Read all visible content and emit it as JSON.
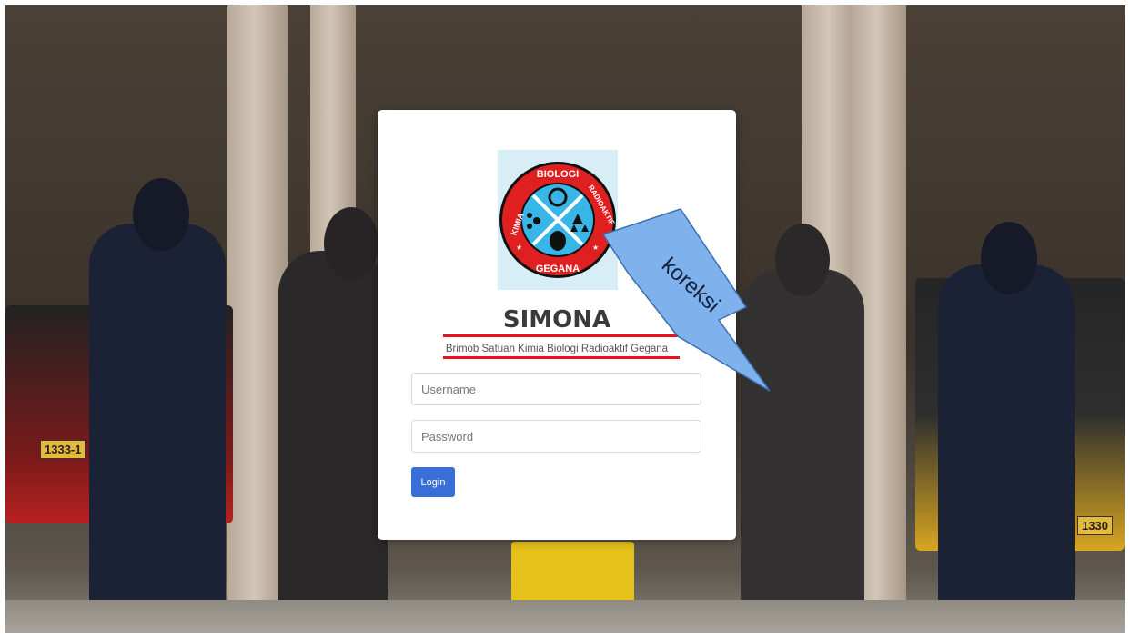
{
  "login": {
    "title": "SIMONA",
    "subtitle": "Brimob Satuan Kimia Biologi Radioaktif Gegana",
    "username_placeholder": "Username",
    "password_placeholder": "Password",
    "login_label": "Login"
  },
  "logo": {
    "top_left_text": "KIMIA",
    "top_text": "BIOLOGI",
    "top_right_text": "RADIOAKTIF",
    "bottom_text": "GEGANA"
  },
  "annotation": {
    "label": "koreksi"
  },
  "background": {
    "plate_left": "1333-1",
    "plate_right": "1330"
  },
  "colors": {
    "accent": "#3a6fd8",
    "annotation_red": "#e8141c",
    "callout_fill": "#7fb2ec",
    "logo_red": "#e02020",
    "logo_blue": "#38b6e8"
  }
}
